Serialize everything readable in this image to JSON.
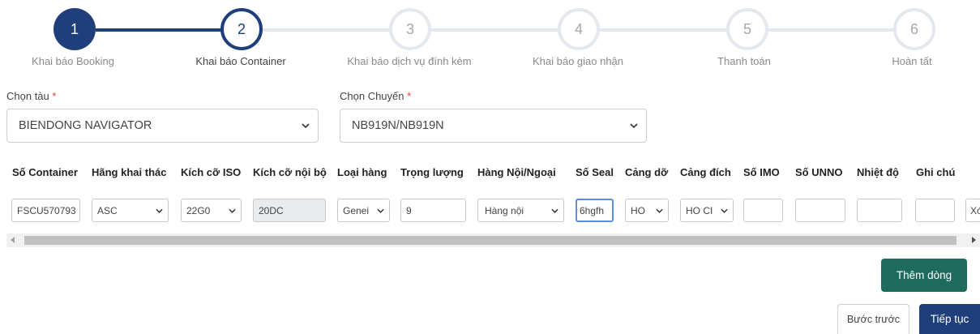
{
  "steps": [
    {
      "number": "1",
      "label": "Khai báo Booking",
      "state": "done"
    },
    {
      "number": "2",
      "label": "Khai báo Container",
      "state": "active"
    },
    {
      "number": "3",
      "label": "Khai báo dịch vụ đính kèm",
      "state": "todo"
    },
    {
      "number": "4",
      "label": "Khai báo giao nhận",
      "state": "todo"
    },
    {
      "number": "5",
      "label": "Thanh toán",
      "state": "todo"
    },
    {
      "number": "6",
      "label": "Hoàn tất",
      "state": "todo"
    }
  ],
  "form": {
    "vessel_label": "Chọn tàu",
    "vessel_value": "BIENDONG NAVIGATOR",
    "voyage_label": "Chọn Chuyến",
    "voyage_value": "NB919N/NB919N",
    "required_mark": "*"
  },
  "table": {
    "headers": [
      "Số Container",
      "Hãng khai thác",
      "Kích cỡ ISO",
      "Kích cỡ nội bộ",
      "Loại hàng",
      "Trọng lượng",
      "Hàng Nội/Ngoại",
      "Số Seal",
      "Cảng dỡ",
      "Cảng đích",
      "Số IMO",
      "Số UNNO",
      "Nhiệt độ",
      "Ghi chú"
    ],
    "row": {
      "container_no": "FSCU570793",
      "operator": "ASC",
      "iso_size": "22G0",
      "internal_size": "20DC",
      "cargo_type": "Genei",
      "weight": "9",
      "domestic_foreign": "Hàng nội",
      "seal_no": "6hgfh",
      "port_discharge": "HO",
      "port_destination": "HO CI",
      "imo": "",
      "unno": "",
      "temperature": "",
      "note": "",
      "delete_partial": "Xó"
    }
  },
  "buttons": {
    "add_row": "Thêm dòng",
    "back": "Bước trước",
    "next": "Tiếp tục"
  },
  "colors": {
    "primary_navy": "#1e3f7a",
    "step_inactive": "#dfe3ea",
    "add_row_bg": "#1d6b5c",
    "next_bg": "#1e3f7a",
    "required": "#e0442b"
  }
}
